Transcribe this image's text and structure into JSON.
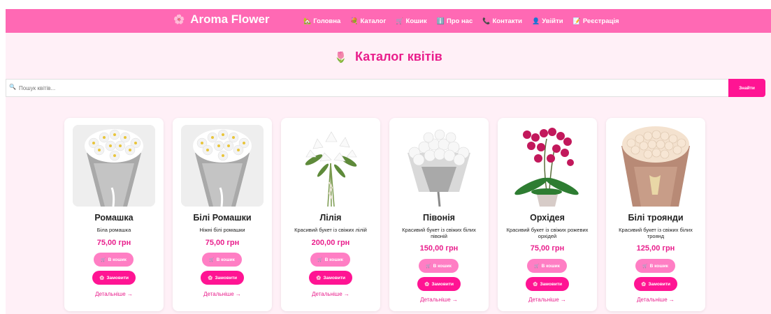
{
  "navbar": {
    "brand_icon": "🌸",
    "brand": "Aroma Flower",
    "items": [
      {
        "icon": "🏡",
        "label": "Головна"
      },
      {
        "icon": "💐",
        "label": "Каталог"
      },
      {
        "icon": "🛒",
        "label": "Кошик"
      },
      {
        "icon": "ℹ️",
        "label": "Про нас"
      },
      {
        "icon": "📞",
        "label": "Контакти"
      },
      {
        "icon": "👤",
        "label": "Увійти"
      },
      {
        "icon": "📝",
        "label": "Реєстрація"
      }
    ]
  },
  "catalog": {
    "icon": "🌷",
    "title": "Каталог квітів"
  },
  "search": {
    "icon": "🔍",
    "placeholder": "Пошук квітів...",
    "button": "Знайти"
  },
  "product_actions": {
    "cart_icon": "🛒",
    "cart_label": "В кошик",
    "order_icon": "🌸",
    "order_label": "Замовити",
    "details_label": "Детальніше →"
  },
  "products": [
    {
      "title": "Ромашка",
      "desc": "Біла ромашка",
      "price": "75,00 грн",
      "image": "white-chamomile-bouquet"
    },
    {
      "title": "Білі Ромашки",
      "desc": "Ніжні білі ромашки",
      "price": "75,00 грн",
      "image": "white-chamomile-bouquet"
    },
    {
      "title": "Лілія",
      "desc": "Красивий букет із свіжих лілій",
      "price": "200,00 грн",
      "image": "white-lily-bouquet"
    },
    {
      "title": "Півонія",
      "desc": "Красивий букет із свіжих білих півоній",
      "price": "150,00 грн",
      "image": "white-peony-bouquet"
    },
    {
      "title": "Орхідея",
      "desc": "Красивий букет із свіжих рожевих орхідей",
      "price": "75,00 грн",
      "image": "pink-orchid-pot"
    },
    {
      "title": "Білі троянди",
      "desc": "Красивий букет із свіжих білих троянд",
      "price": "125,00 грн",
      "image": "white-rose-bouquet"
    }
  ],
  "colors": {
    "navbar": "#ff69b4",
    "accent": "#e91e8c",
    "button_primary": "#ff1493",
    "button_cart": "#ff7ec4",
    "page_bg": "#fff0f7"
  }
}
